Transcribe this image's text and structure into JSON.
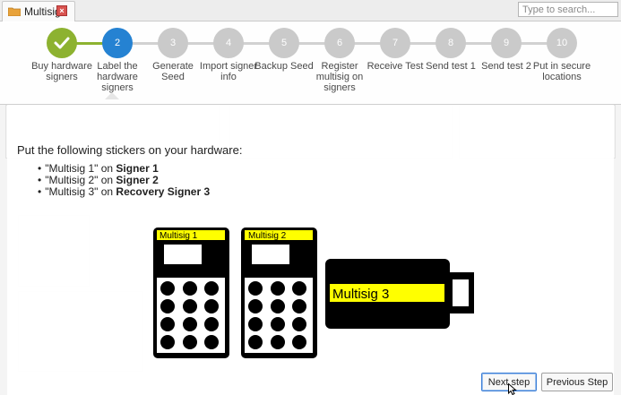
{
  "tab": {
    "label": "Multisig",
    "close_symbol": "×",
    "folder_color": "#e8a23a"
  },
  "search": {
    "placeholder": "Type to search..."
  },
  "stepper": {
    "colors": {
      "done": "#8ab02a",
      "active": "#1f7fd1",
      "pending": "#c9c9c9"
    },
    "steps": [
      {
        "number": "",
        "label": "Buy hardware signers",
        "state": "done",
        "icon": "check-icon"
      },
      {
        "number": "2",
        "label": "Label the hardware signers",
        "state": "active"
      },
      {
        "number": "3",
        "label": "Generate Seed",
        "state": "pending"
      },
      {
        "number": "4",
        "label": "Import signer info",
        "state": "pending"
      },
      {
        "number": "5",
        "label": "Backup Seed",
        "state": "pending"
      },
      {
        "number": "6",
        "label": "Register multisig on signers",
        "state": "pending"
      },
      {
        "number": "7",
        "label": "Receive Test",
        "state": "pending"
      },
      {
        "number": "8",
        "label": "Send test 1",
        "state": "pending"
      },
      {
        "number": "9",
        "label": "Send test 2",
        "state": "pending"
      },
      {
        "number": "10",
        "label": "Put in secure locations",
        "state": "pending"
      }
    ]
  },
  "content": {
    "intro": "Put the following stickers on your hardware:",
    "stickers": [
      {
        "sticker": "\"Multisig 1\"",
        "on": " on ",
        "target": "Signer 1"
      },
      {
        "sticker": "\"Multisig 2\"",
        "on": " on ",
        "target": "Signer 2"
      },
      {
        "sticker": "\"Multisig 3\"",
        "on": " on ",
        "target": "Recovery Signer 3"
      }
    ],
    "devices": [
      {
        "label": "Multisig 1",
        "kind": "keypad-signer"
      },
      {
        "label": "Multisig 2",
        "kind": "keypad-signer"
      },
      {
        "label": "Multisig 3",
        "kind": "usb-signer"
      }
    ],
    "sticker_color": "#ffff00"
  },
  "buttons": {
    "next": "Next step",
    "previous": "Previous Step"
  }
}
